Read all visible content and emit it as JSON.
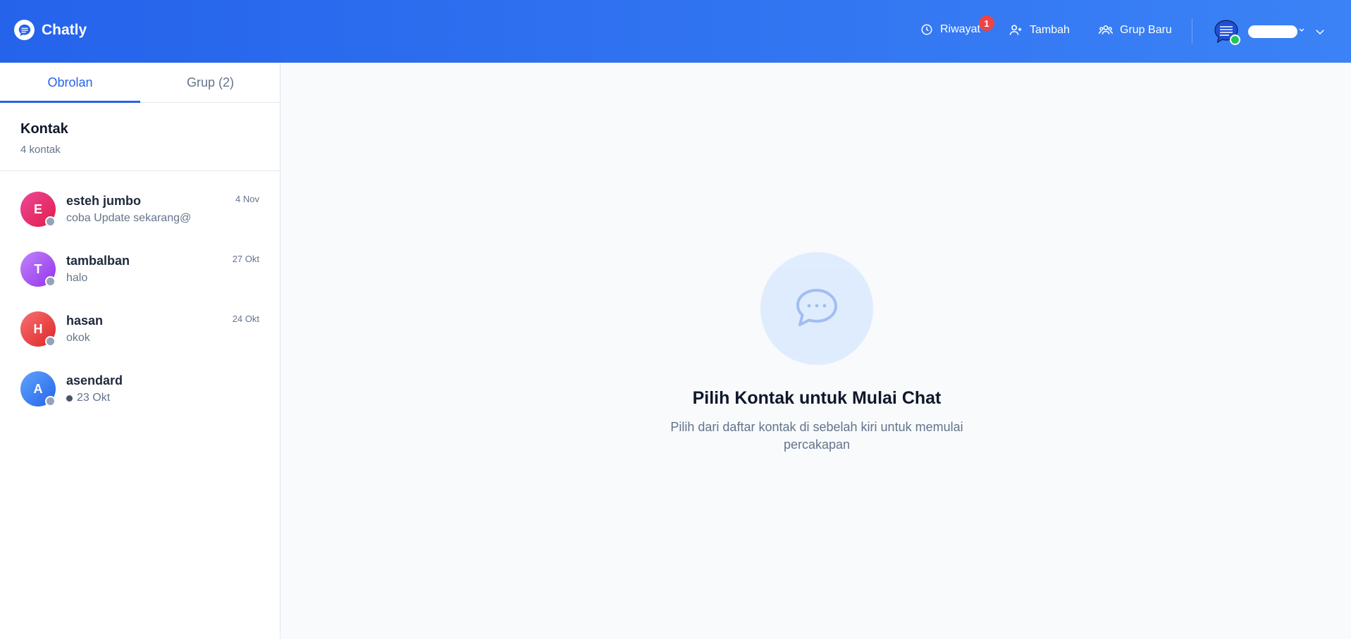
{
  "header": {
    "app_name": "Chatly",
    "actions": [
      {
        "label": "Riwayat",
        "icon": "clock-icon",
        "badge": "1"
      },
      {
        "label": "Tambah",
        "icon": "user-plus-icon"
      },
      {
        "label": "Grup Baru",
        "icon": "users-icon"
      }
    ],
    "user": {
      "status": "online",
      "status_color": "#22c55e"
    }
  },
  "sidebar": {
    "tabs": [
      {
        "label": "Obrolan",
        "active": true
      },
      {
        "label": "Grup (2)",
        "active": false
      }
    ],
    "contacts_title": "Kontak",
    "contacts_count": "4 kontak",
    "contacts": [
      {
        "initial": "E",
        "name": "esteh jumbo",
        "message": "coba Update sekarang@",
        "time": "4 Nov",
        "color": "#e8467c"
      },
      {
        "initial": "T",
        "name": "tambalban",
        "message": "halo",
        "time": "27 Okt",
        "color": "#a855f7"
      },
      {
        "initial": "H",
        "name": "hasan",
        "message": "okok",
        "time": "24 Okt",
        "color": "#ef4444"
      },
      {
        "initial": "A",
        "name": "asendard",
        "message": "23 Okt",
        "time": "",
        "color": "#3b82f6"
      }
    ]
  },
  "main": {
    "empty_icon": "chat-bubble-icon",
    "empty_title": "Pilih Kontak untuk Mulai Chat",
    "empty_subtitle": "Pilih dari daftar kontak di sebelah kiri untuk memulai percakapan"
  },
  "colors": {
    "primary": "#2563eb",
    "badge": "#ef4444",
    "offline": "#94a3b8"
  }
}
